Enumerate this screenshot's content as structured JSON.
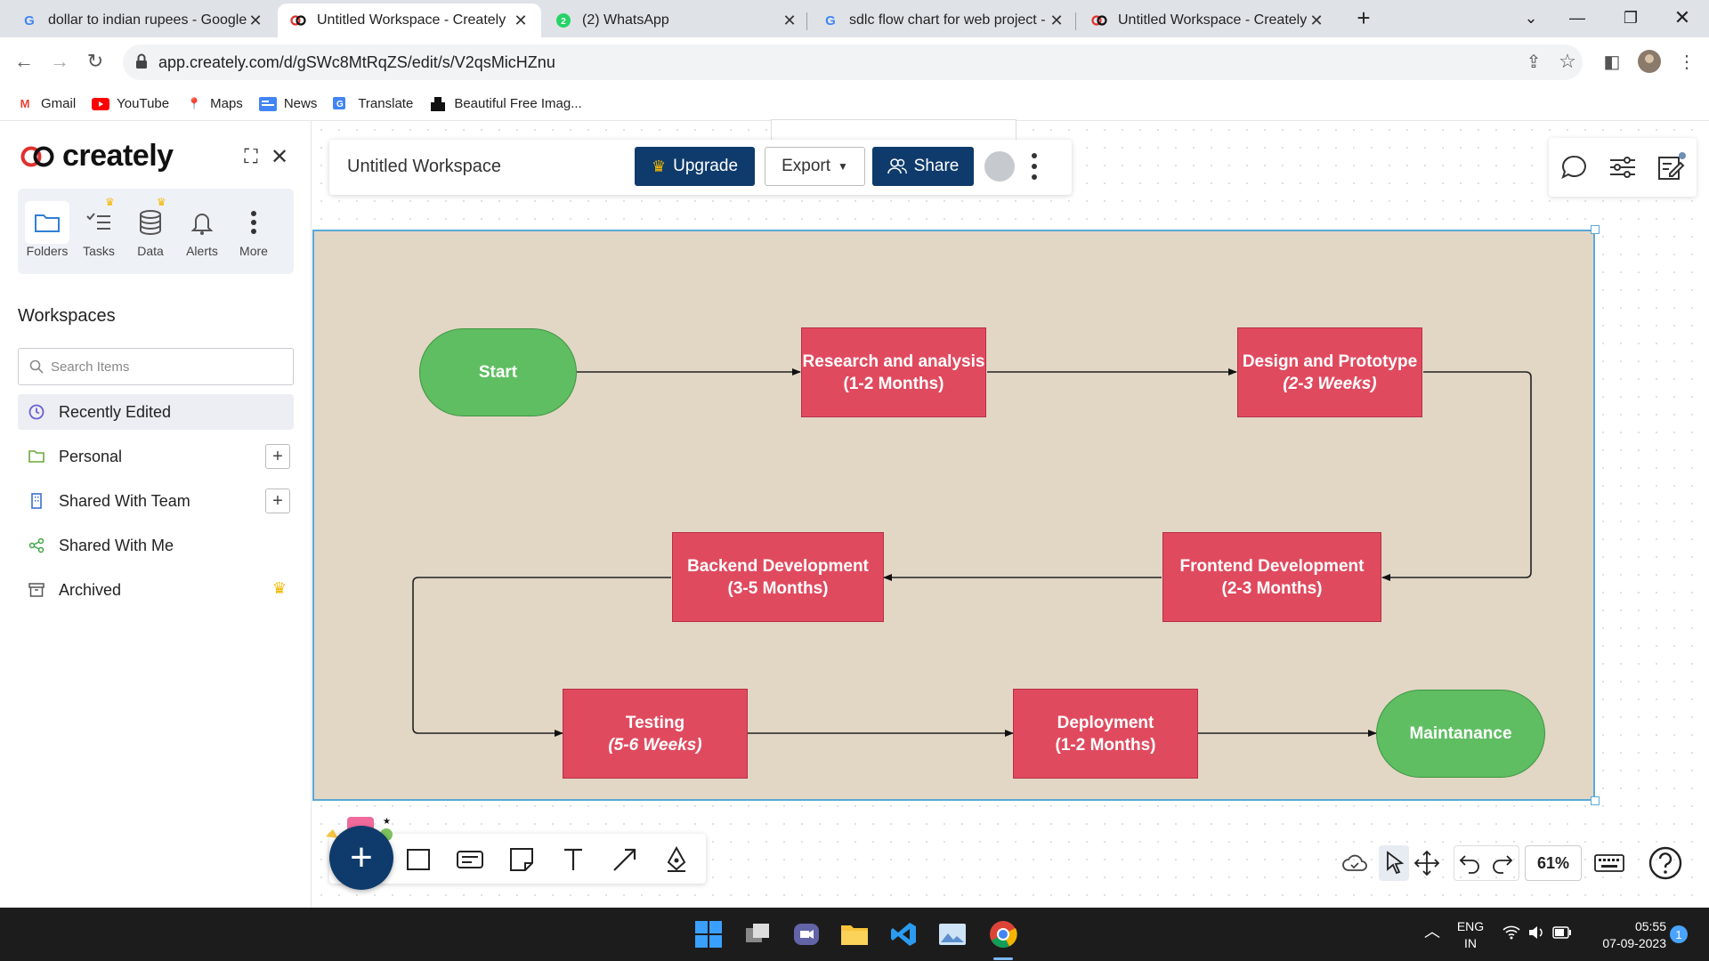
{
  "browser": {
    "tabs": [
      {
        "title": "dollar to indian rupees - Google",
        "favicon": "G"
      },
      {
        "title": "Untitled Workspace - Creately",
        "favicon": "creately"
      },
      {
        "title": "(2) WhatsApp",
        "favicon": "whatsapp"
      },
      {
        "title": "sdlc flow chart for web project - G",
        "favicon": "G"
      },
      {
        "title": "Untitled Workspace - Creately",
        "favicon": "creately"
      }
    ],
    "url": "app.creately.com/d/gSWc8MtRqZS/edit/s/V2qsMicHZnu",
    "bookmarks": [
      "Gmail",
      "YouTube",
      "Maps",
      "News",
      "Translate",
      "Beautiful Free Imag..."
    ]
  },
  "sidebar": {
    "logo": "creately",
    "quicknav": [
      {
        "label": "Folders",
        "premium": false
      },
      {
        "label": "Tasks",
        "premium": true
      },
      {
        "label": "Data",
        "premium": true
      },
      {
        "label": "Alerts",
        "premium": false
      },
      {
        "label": "More",
        "premium": false
      }
    ],
    "workspaces_heading": "Workspaces",
    "search_placeholder": "Search Items",
    "items": [
      {
        "label": "Recently Edited"
      },
      {
        "label": "Personal"
      },
      {
        "label": "Shared With Team"
      },
      {
        "label": "Shared With Me"
      },
      {
        "label": "Archived"
      }
    ]
  },
  "toolbar": {
    "workspace_title": "Untitled Workspace",
    "upgrade_label": "Upgrade",
    "export_label": "Export",
    "share_label": "Share"
  },
  "diagram": {
    "start": "Start",
    "research": {
      "title": "Research and analysis",
      "duration": "(1-2 Months)"
    },
    "design": {
      "title": "Design and Prototype",
      "duration": "(2-3 Weeks)"
    },
    "frontend": {
      "title": "Frontend Development",
      "duration": "(2-3 Months)"
    },
    "backend": {
      "title": "Backend Development",
      "duration": "(3-5 Months)"
    },
    "testing": {
      "title": "Testing",
      "duration": "(5-6 Weeks)"
    },
    "deployment": {
      "title": "Deployment",
      "duration": "(1-2 Months)"
    },
    "maintenance": "Maintanance",
    "colors": {
      "process": "#e04a5f",
      "terminal": "#5fbe62",
      "background": "#e2d6c5"
    }
  },
  "bottom": {
    "zoom": "61%"
  },
  "taskbar": {
    "lang_line1": "ENG",
    "lang_line2": "IN",
    "time": "05:55",
    "date": "07-09-2023",
    "notification_count": "1"
  }
}
